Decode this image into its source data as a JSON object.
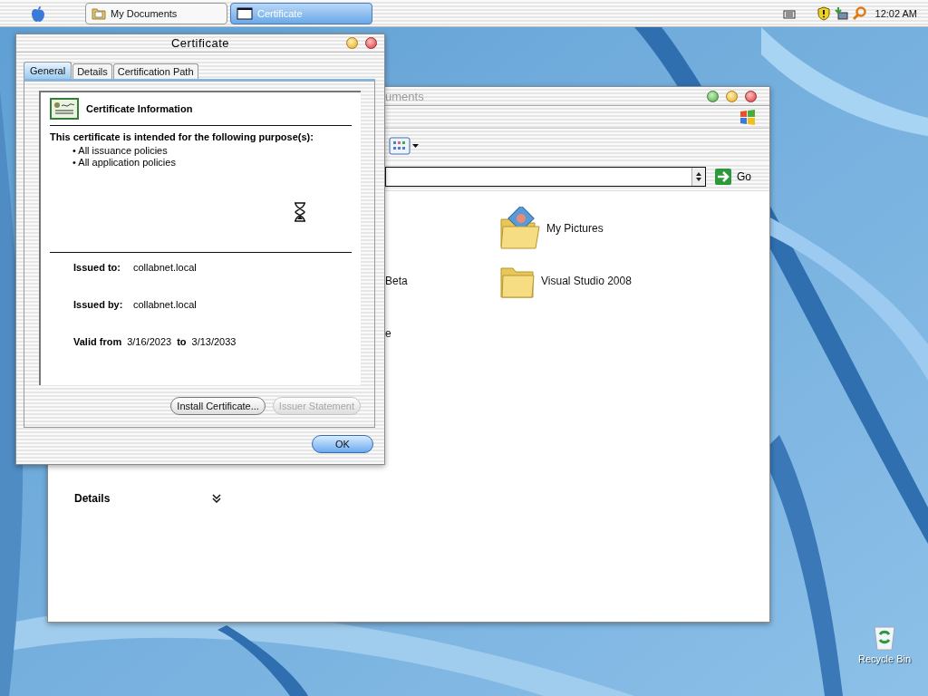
{
  "taskbar": {
    "tasks": [
      {
        "label": "My Documents",
        "kind": "folder",
        "selected": false
      },
      {
        "label": "Certificate",
        "kind": "window",
        "selected": true
      }
    ],
    "clock": "12:02 AM"
  },
  "desktop_icons": [
    {
      "label": "Recycle Bin"
    }
  ],
  "explorer": {
    "title": "uments",
    "go": "Go",
    "rows": [
      {
        "right": {
          "label": "My Pictures",
          "kind": "pictures"
        }
      },
      {
        "left": "Beta",
        "right": {
          "label": "Visual Studio 2008",
          "kind": "folder"
        }
      },
      {
        "left": "e"
      }
    ],
    "details": {
      "title": "Details",
      "expanded": false
    }
  },
  "dialog": {
    "title": "Certificate",
    "tabs": [
      {
        "label": "General",
        "selected": true
      },
      {
        "label": "Details",
        "selected": false
      },
      {
        "label": "Certification Path",
        "selected": false
      }
    ],
    "heading": "Certificate Information",
    "purpose_label": "This certificate is intended for the following purpose(s):",
    "purposes": [
      "• All issuance policies",
      "• All application policies"
    ],
    "issued_to": {
      "label": "Issued to:",
      "value": "collabnet.local"
    },
    "issued_by": {
      "label": "Issued by:",
      "value": "collabnet.local"
    },
    "valid": {
      "from_label": "Valid from",
      "from": "3/16/2023",
      "to_label": "to",
      "to": "3/13/2033"
    },
    "buttons": [
      {
        "label": "Install Certificate...",
        "disabled": false
      },
      {
        "label": "Issuer Statement",
        "disabled": true
      }
    ],
    "ok": "OK"
  }
}
